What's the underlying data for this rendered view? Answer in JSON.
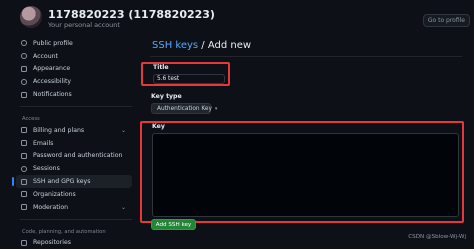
{
  "header": {
    "user_name": "1178820223 (1178820223)",
    "user_subtitle": "Your personal account",
    "profile_button": "Go to profile"
  },
  "sidebar": {
    "items_top": [
      {
        "label": "Public profile",
        "icon": "person-icon"
      },
      {
        "label": "Account",
        "icon": "gear-icon"
      },
      {
        "label": "Appearance",
        "icon": "paintbrush-icon"
      },
      {
        "label": "Accessibility",
        "icon": "accessibility-icon"
      },
      {
        "label": "Notifications",
        "icon": "bell-icon"
      }
    ],
    "section_access": "Access",
    "items_access": [
      {
        "label": "Billing and plans",
        "icon": "credit-card-icon"
      },
      {
        "label": "Emails",
        "icon": "mail-icon"
      },
      {
        "label": "Password and authentication",
        "icon": "shield-lock-icon"
      },
      {
        "label": "Sessions",
        "icon": "broadcast-icon"
      },
      {
        "label": "SSH and GPG keys",
        "icon": "key-icon"
      },
      {
        "label": "Organizations",
        "icon": "organization-icon"
      },
      {
        "label": "Moderation",
        "icon": "report-icon"
      }
    ],
    "section_code": "Code, planning, and automation",
    "items_code": [
      {
        "label": "Repositories",
        "icon": "repo-icon"
      }
    ]
  },
  "main": {
    "breadcrumb": "SSH keys",
    "separator": "/",
    "title": "Add new",
    "title_label": "Title",
    "title_value": "5.6 test",
    "key_type_label": "Key type",
    "key_type_value": "Authentication Key",
    "key_label": "Key",
    "key_value": "",
    "submit_label": "Add SSH key"
  },
  "watermark": "CSDN @Sblow-Wj-Wj",
  "colors": {
    "background": "#0d1117",
    "accent": "#2f81f7",
    "link": "#58a6ff",
    "primary_button": "#238636",
    "highlight_box": "#e5383b"
  }
}
